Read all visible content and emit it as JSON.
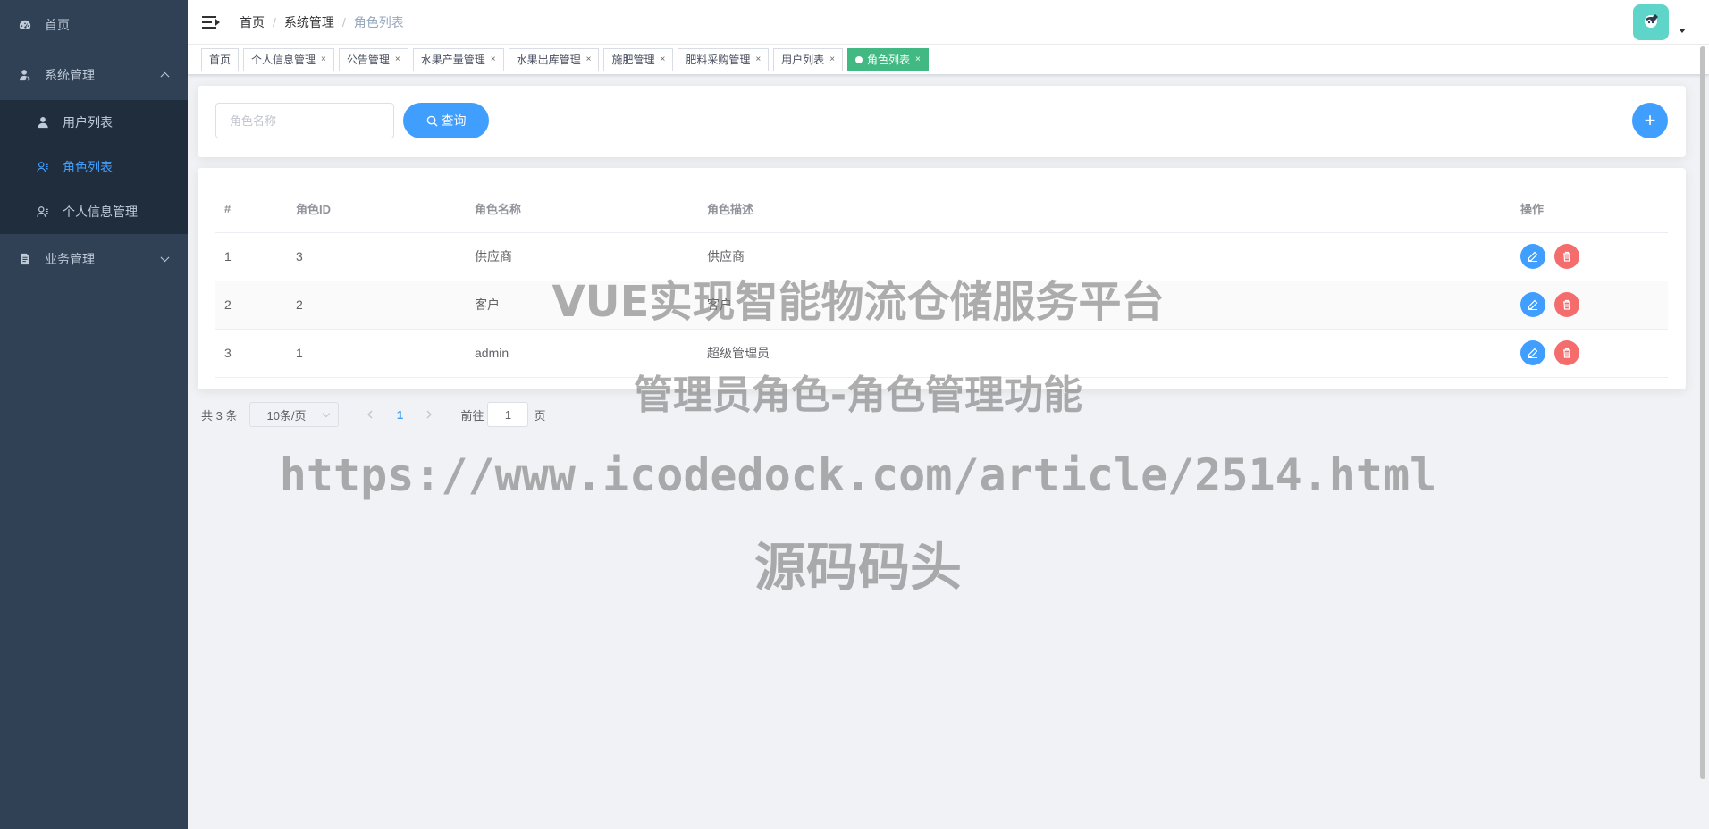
{
  "sidebar": {
    "home": {
      "label": "首页",
      "icon": "dashboard-icon"
    },
    "system": {
      "label": "系统管理",
      "icon": "user-icon",
      "items": [
        {
          "label": "用户列表",
          "icon": "user-icon"
        },
        {
          "label": "角色列表",
          "icon": "peoples-icon",
          "active": true
        },
        {
          "label": "个人信息管理",
          "icon": "peoples-icon"
        }
      ]
    },
    "business": {
      "label": "业务管理",
      "icon": "document-icon"
    }
  },
  "navbar": {
    "breadcrumb": [
      "首页",
      "系统管理",
      "角色列表"
    ],
    "separator": "/"
  },
  "tags": [
    {
      "label": "首页",
      "closable": false
    },
    {
      "label": "个人信息管理",
      "closable": true
    },
    {
      "label": "公告管理",
      "closable": true
    },
    {
      "label": "水果产量管理",
      "closable": true
    },
    {
      "label": "水果出库管理",
      "closable": true
    },
    {
      "label": "施肥管理",
      "closable": true
    },
    {
      "label": "肥料采购管理",
      "closable": true
    },
    {
      "label": "用户列表",
      "closable": true
    },
    {
      "label": "角色列表",
      "closable": true,
      "active": true
    }
  ],
  "tag_close": "×",
  "search": {
    "placeholder": "角色名称",
    "query_label": "查询",
    "add_label": "+"
  },
  "table": {
    "headers": [
      "#",
      "角色ID",
      "角色名称",
      "角色描述",
      "操作"
    ],
    "rows": [
      [
        "1",
        "3",
        "供应商",
        "供应商"
      ],
      [
        "2",
        "2",
        "客户",
        "客户"
      ],
      [
        "3",
        "1",
        "admin",
        "超级管理员"
      ]
    ]
  },
  "pagination": {
    "total": "共 3 条",
    "page_size": "10条/页",
    "current_page": "1",
    "goto_prefix": "前往",
    "goto_value": "1",
    "goto_suffix": "页"
  },
  "watermark": {
    "line1": "VUE实现智能物流仓储服务平台",
    "line2": "管理员角色-角色管理功能",
    "line3": "https://www.icodedock.com/article/2514.html",
    "line4": "源码码头"
  },
  "colors": {
    "sidebar_bg": "#304156",
    "submenu_bg": "#1f2d3d",
    "primary": "#409eff",
    "danger": "#f56c6c",
    "active_tag": "#42b983"
  }
}
